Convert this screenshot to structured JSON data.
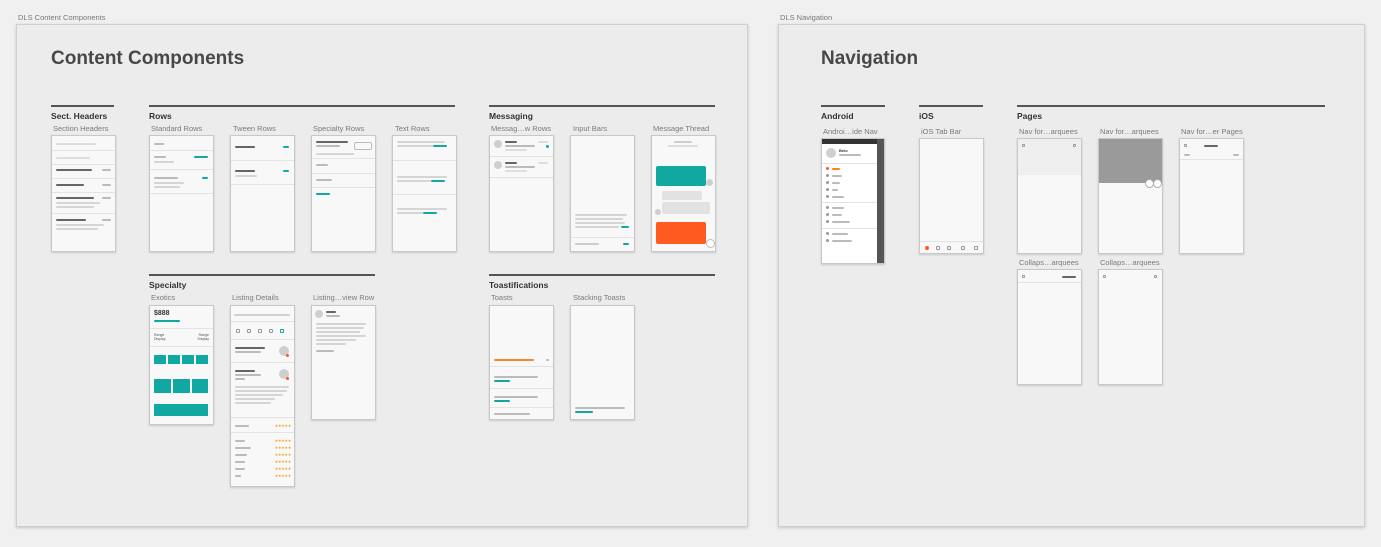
{
  "boards": {
    "content": {
      "frame_label": "DLS Content Components",
      "title": "Content Components",
      "sections": {
        "sect_headers": "Sect. Headers",
        "rows": "Rows",
        "messaging": "Messaging",
        "specialty": "Specialty",
        "toastifications": "Toastifications"
      },
      "artboards": {
        "section_headers": "Section Headers",
        "standard_rows": "Standard Rows",
        "tween_rows": "Tween Rows",
        "specialty_rows": "Specialty Rows",
        "text_rows": "Text Rows",
        "messaging_rows": "Messag…w Rows",
        "input_bars": "Input Bars",
        "message_thread": "Message Thread",
        "exotics": "Exotics",
        "listing_details": "Listing Details",
        "listing_review_row": "Listing…view Row",
        "toasts": "Toasts",
        "stacking_toasts": "Stacking Toasts"
      }
    },
    "navigation": {
      "frame_label": "DLS Navigation",
      "title": "Navigation",
      "sections": {
        "android": "Android",
        "ios": "iOS",
        "pages": "Pages"
      },
      "artboards": {
        "android_side_nav": "Androi…ide Nav",
        "ios_tab_bar": "iOS Tab Bar",
        "nav_marquees_1": "Nav for…arquees",
        "nav_marquees_2": "Nav for…arquees",
        "nav_pages": "Nav for…er Pages",
        "collaps_marquees_1": "Collaps…arquees",
        "collaps_marquees_2": "Collaps…arquees"
      }
    }
  },
  "mockup_text": {
    "side_nav_user": "Belo",
    "exotics_price": "$888",
    "exotics_left": "Range Display",
    "exotics_right": "Range Display"
  },
  "colors": {
    "accent_teal": "#10a8a0",
    "accent_orange": "#ff5a1f",
    "board_bg": "#ececec",
    "canvas_bg": "#f0f0f0"
  }
}
